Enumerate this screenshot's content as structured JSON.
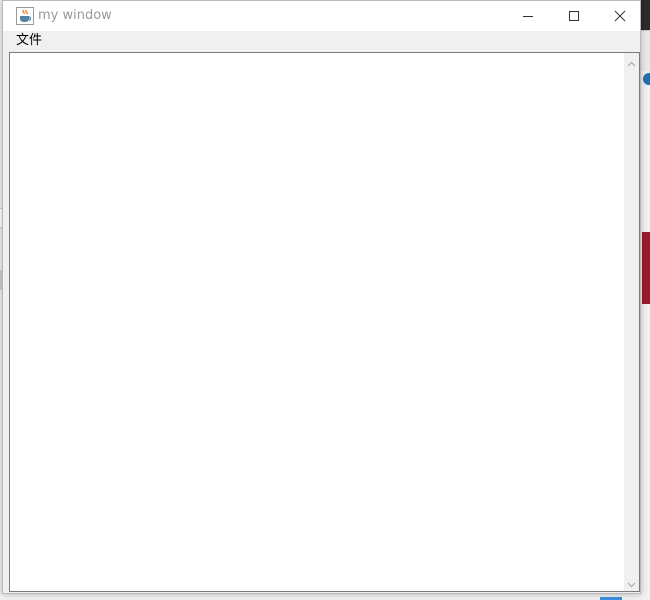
{
  "window": {
    "title": "my window",
    "icon": "java-cup-icon",
    "controls": {
      "minimize_icon": "minimize-icon",
      "maximize_icon": "maximize-icon",
      "close_icon": "close-icon"
    }
  },
  "menubar": {
    "items": [
      {
        "label": "文件"
      }
    ]
  },
  "editor": {
    "value": "",
    "scrollbar": {
      "up_icon": "chevron-up-icon",
      "down_icon": "chevron-down-icon"
    }
  },
  "colors": {
    "titlebar_bg": "#ffffff",
    "title_text": "#9a9a9a",
    "chrome_bg": "#f0f0f0",
    "editor_bg": "#ffffff",
    "editor_border": "#7a7a7a"
  }
}
